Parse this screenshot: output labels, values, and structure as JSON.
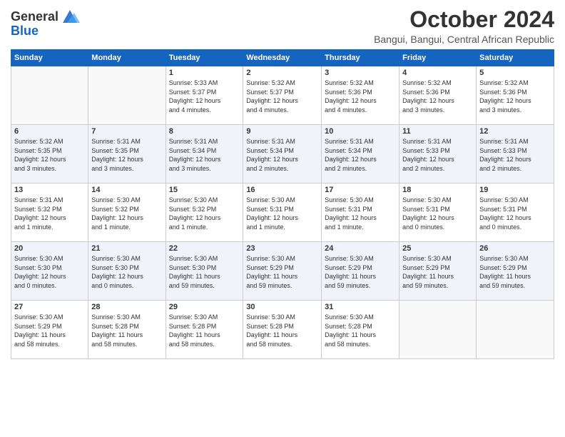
{
  "logo": {
    "line1": "General",
    "line2": "Blue"
  },
  "title": "October 2024",
  "location": "Bangui, Bangui, Central African Republic",
  "days_header": [
    "Sunday",
    "Monday",
    "Tuesday",
    "Wednesday",
    "Thursday",
    "Friday",
    "Saturday"
  ],
  "weeks": [
    [
      {
        "day": "",
        "info": ""
      },
      {
        "day": "",
        "info": ""
      },
      {
        "day": "1",
        "info": "Sunrise: 5:33 AM\nSunset: 5:37 PM\nDaylight: 12 hours\nand 4 minutes."
      },
      {
        "day": "2",
        "info": "Sunrise: 5:32 AM\nSunset: 5:37 PM\nDaylight: 12 hours\nand 4 minutes."
      },
      {
        "day": "3",
        "info": "Sunrise: 5:32 AM\nSunset: 5:36 PM\nDaylight: 12 hours\nand 4 minutes."
      },
      {
        "day": "4",
        "info": "Sunrise: 5:32 AM\nSunset: 5:36 PM\nDaylight: 12 hours\nand 3 minutes."
      },
      {
        "day": "5",
        "info": "Sunrise: 5:32 AM\nSunset: 5:36 PM\nDaylight: 12 hours\nand 3 minutes."
      }
    ],
    [
      {
        "day": "6",
        "info": "Sunrise: 5:32 AM\nSunset: 5:35 PM\nDaylight: 12 hours\nand 3 minutes."
      },
      {
        "day": "7",
        "info": "Sunrise: 5:31 AM\nSunset: 5:35 PM\nDaylight: 12 hours\nand 3 minutes."
      },
      {
        "day": "8",
        "info": "Sunrise: 5:31 AM\nSunset: 5:34 PM\nDaylight: 12 hours\nand 3 minutes."
      },
      {
        "day": "9",
        "info": "Sunrise: 5:31 AM\nSunset: 5:34 PM\nDaylight: 12 hours\nand 2 minutes."
      },
      {
        "day": "10",
        "info": "Sunrise: 5:31 AM\nSunset: 5:34 PM\nDaylight: 12 hours\nand 2 minutes."
      },
      {
        "day": "11",
        "info": "Sunrise: 5:31 AM\nSunset: 5:33 PM\nDaylight: 12 hours\nand 2 minutes."
      },
      {
        "day": "12",
        "info": "Sunrise: 5:31 AM\nSunset: 5:33 PM\nDaylight: 12 hours\nand 2 minutes."
      }
    ],
    [
      {
        "day": "13",
        "info": "Sunrise: 5:31 AM\nSunset: 5:32 PM\nDaylight: 12 hours\nand 1 minute."
      },
      {
        "day": "14",
        "info": "Sunrise: 5:30 AM\nSunset: 5:32 PM\nDaylight: 12 hours\nand 1 minute."
      },
      {
        "day": "15",
        "info": "Sunrise: 5:30 AM\nSunset: 5:32 PM\nDaylight: 12 hours\nand 1 minute."
      },
      {
        "day": "16",
        "info": "Sunrise: 5:30 AM\nSunset: 5:31 PM\nDaylight: 12 hours\nand 1 minute."
      },
      {
        "day": "17",
        "info": "Sunrise: 5:30 AM\nSunset: 5:31 PM\nDaylight: 12 hours\nand 1 minute."
      },
      {
        "day": "18",
        "info": "Sunrise: 5:30 AM\nSunset: 5:31 PM\nDaylight: 12 hours\nand 0 minutes."
      },
      {
        "day": "19",
        "info": "Sunrise: 5:30 AM\nSunset: 5:31 PM\nDaylight: 12 hours\nand 0 minutes."
      }
    ],
    [
      {
        "day": "20",
        "info": "Sunrise: 5:30 AM\nSunset: 5:30 PM\nDaylight: 12 hours\nand 0 minutes."
      },
      {
        "day": "21",
        "info": "Sunrise: 5:30 AM\nSunset: 5:30 PM\nDaylight: 12 hours\nand 0 minutes."
      },
      {
        "day": "22",
        "info": "Sunrise: 5:30 AM\nSunset: 5:30 PM\nDaylight: 11 hours\nand 59 minutes."
      },
      {
        "day": "23",
        "info": "Sunrise: 5:30 AM\nSunset: 5:29 PM\nDaylight: 11 hours\nand 59 minutes."
      },
      {
        "day": "24",
        "info": "Sunrise: 5:30 AM\nSunset: 5:29 PM\nDaylight: 11 hours\nand 59 minutes."
      },
      {
        "day": "25",
        "info": "Sunrise: 5:30 AM\nSunset: 5:29 PM\nDaylight: 11 hours\nand 59 minutes."
      },
      {
        "day": "26",
        "info": "Sunrise: 5:30 AM\nSunset: 5:29 PM\nDaylight: 11 hours\nand 59 minutes."
      }
    ],
    [
      {
        "day": "27",
        "info": "Sunrise: 5:30 AM\nSunset: 5:29 PM\nDaylight: 11 hours\nand 58 minutes."
      },
      {
        "day": "28",
        "info": "Sunrise: 5:30 AM\nSunset: 5:28 PM\nDaylight: 11 hours\nand 58 minutes."
      },
      {
        "day": "29",
        "info": "Sunrise: 5:30 AM\nSunset: 5:28 PM\nDaylight: 11 hours\nand 58 minutes."
      },
      {
        "day": "30",
        "info": "Sunrise: 5:30 AM\nSunset: 5:28 PM\nDaylight: 11 hours\nand 58 minutes."
      },
      {
        "day": "31",
        "info": "Sunrise: 5:30 AM\nSunset: 5:28 PM\nDaylight: 11 hours\nand 58 minutes."
      },
      {
        "day": "",
        "info": ""
      },
      {
        "day": "",
        "info": ""
      }
    ]
  ]
}
